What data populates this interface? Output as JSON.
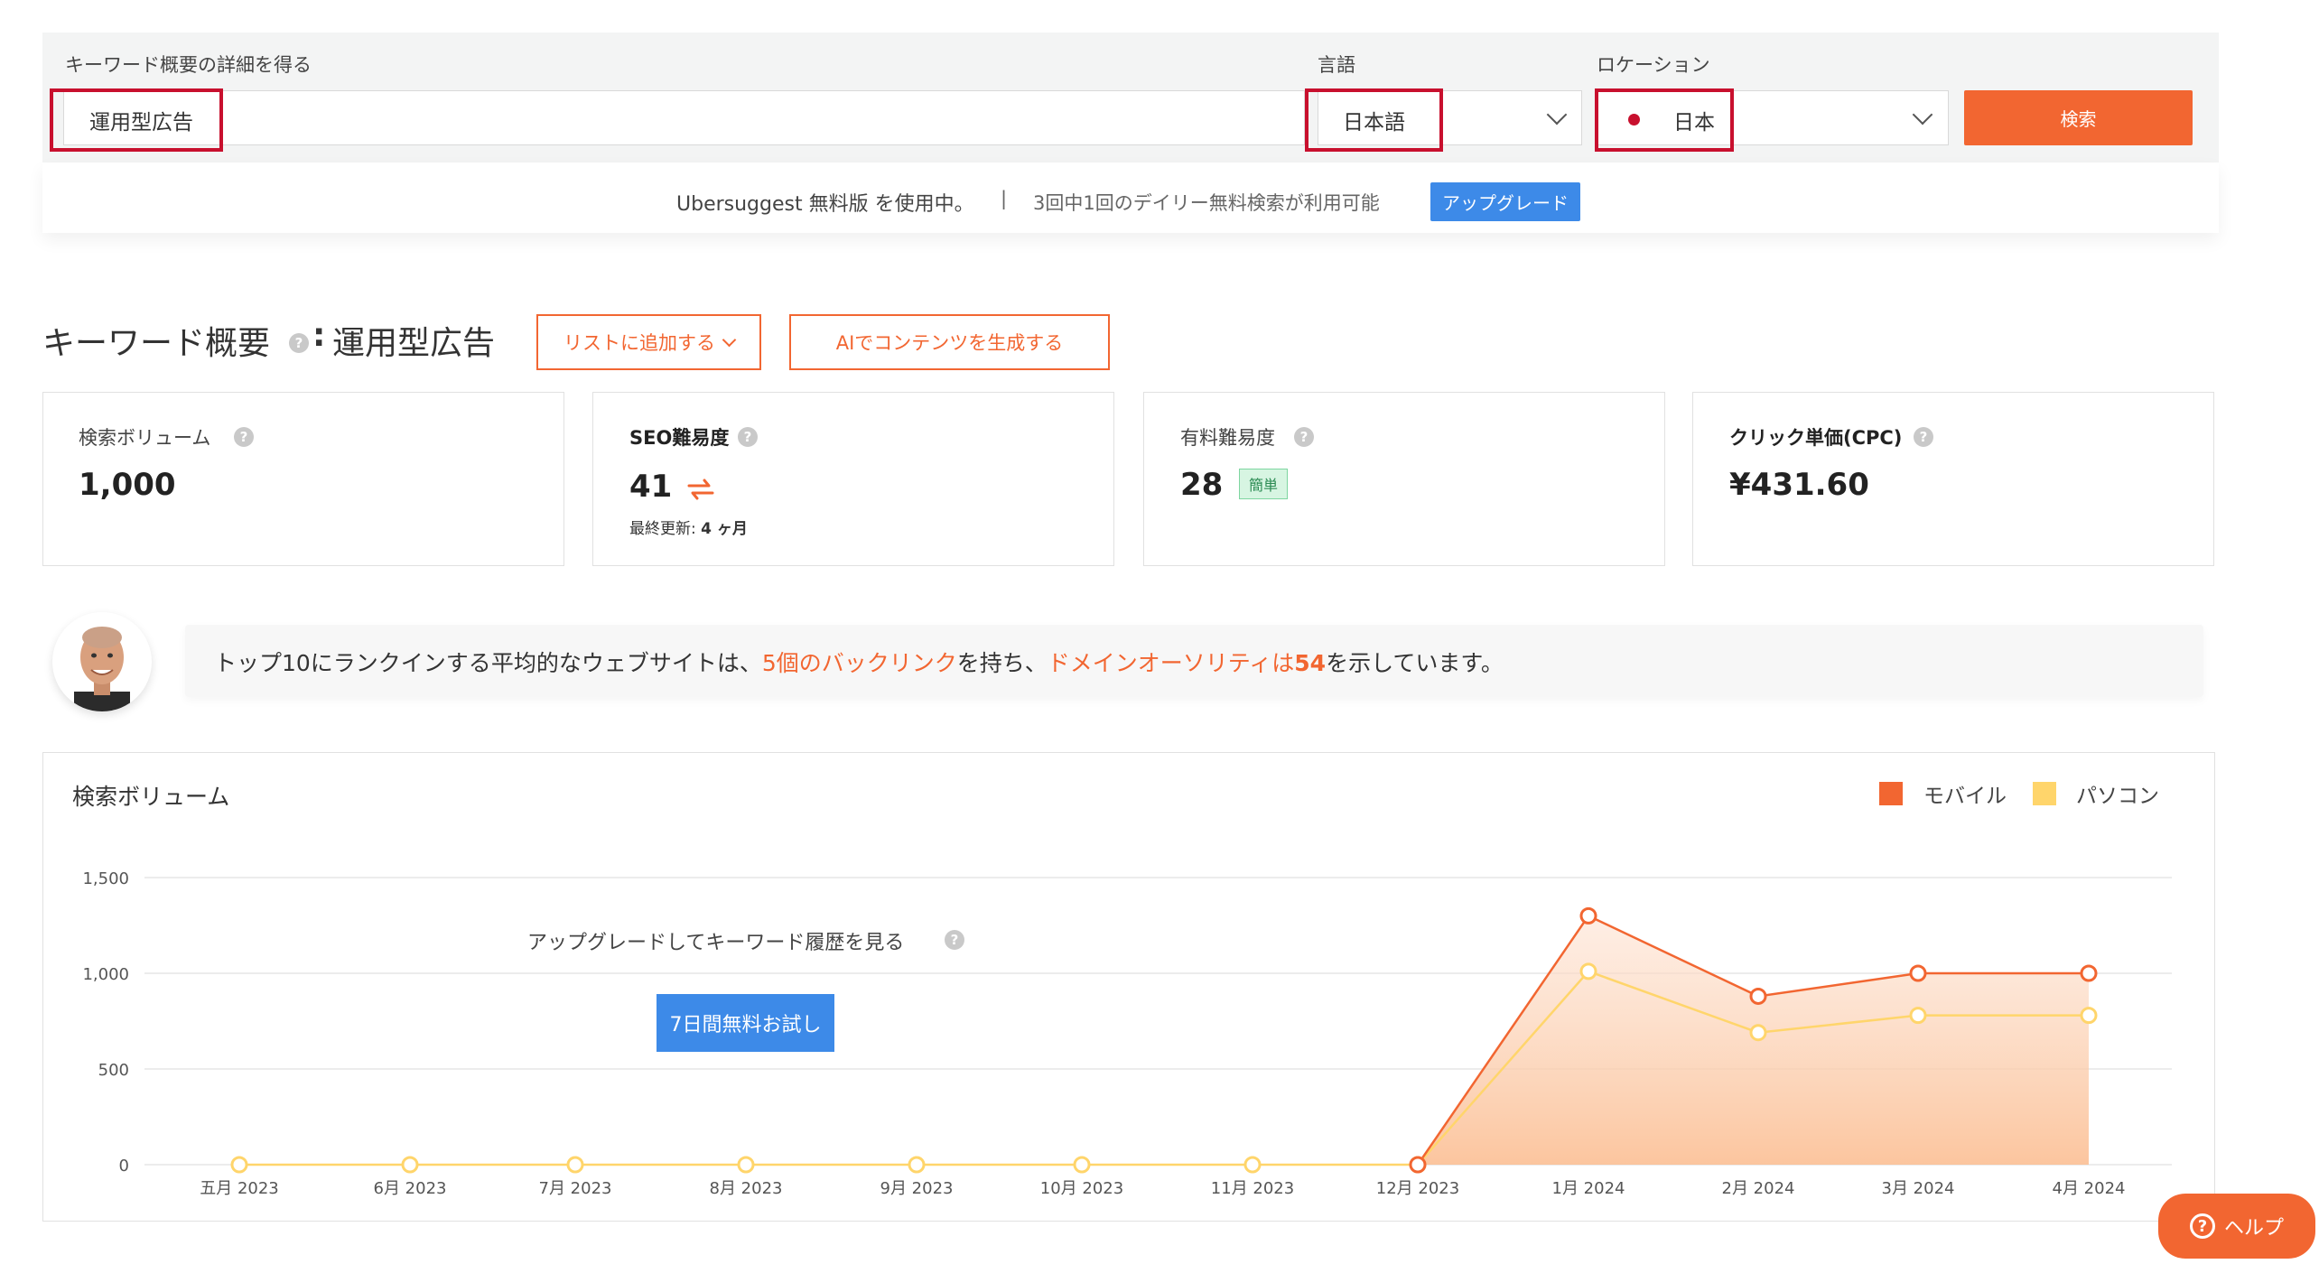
{
  "search": {
    "keyword_label": "キーワード概要の詳細を得る",
    "keyword_value": "運用型広告",
    "language_label": "言語",
    "language_value": "日本語",
    "location_label": "ロケーション",
    "location_value": "日本",
    "search_button": "検索"
  },
  "free_bar": {
    "message": "Ubersuggest 無料版 を使用中。",
    "separator": "|",
    "remaining": "3回中1回のデイリー無料検索が利用可能",
    "upgrade_button": "アップグレード"
  },
  "overview": {
    "title_prefix": "キーワード概要",
    "title_colon": ":",
    "keyword": "運用型広告",
    "add_to_list_button": "リストに追加する",
    "ai_button": "AIでコンテンツを生成する"
  },
  "metrics": [
    {
      "label": "検索ボリューム",
      "value": "1,000"
    },
    {
      "label": "SEO難易度",
      "value": "41",
      "sub_prefix": "最終更新:",
      "sub_value": "4 ヶ月"
    },
    {
      "label": "有料難易度",
      "value": "28",
      "badge": "簡単"
    },
    {
      "label": "クリック単価(CPC)",
      "value": "¥431.60"
    }
  ],
  "tip": {
    "part1": "トップ10にランクインする平均的なウェブサイトは、",
    "highlight1": "5個のバックリンク",
    "part2": "を持ち、",
    "highlight2": "ドメインオーソリティは",
    "highlight3": "54",
    "part3": "を示しています。"
  },
  "chart_overlay": {
    "upgrade_text": "アップグレードしてキーワード履歴を見る",
    "trial_button": "7日間無料お試し"
  },
  "help_button": "ヘルプ",
  "colors": {
    "accent": "#f26631",
    "blue": "#3d8ae8",
    "mobile": "#f26631",
    "desktop": "#ffd56b"
  },
  "chart_data": {
    "type": "line",
    "title": "検索ボリューム",
    "categories": [
      "五月 2023",
      "6月 2023",
      "7月 2023",
      "8月 2023",
      "9月 2023",
      "10月 2023",
      "11月 2023",
      "12月 2023",
      "1月 2024",
      "2月 2024",
      "3月 2024",
      "4月 2024"
    ],
    "series": [
      {
        "name": "モバイル",
        "values": [
          0,
          0,
          0,
          0,
          0,
          0,
          0,
          0,
          1300,
          880,
          1000,
          1000
        ]
      },
      {
        "name": "パソコン",
        "values": [
          0,
          0,
          0,
          0,
          0,
          0,
          0,
          0,
          1010,
          690,
          780,
          780
        ]
      }
    ],
    "yticks": [
      "0",
      "500",
      "1,000",
      "1,500"
    ],
    "ylim": [
      0,
      1500
    ],
    "grid": true,
    "legend": "top-right"
  }
}
